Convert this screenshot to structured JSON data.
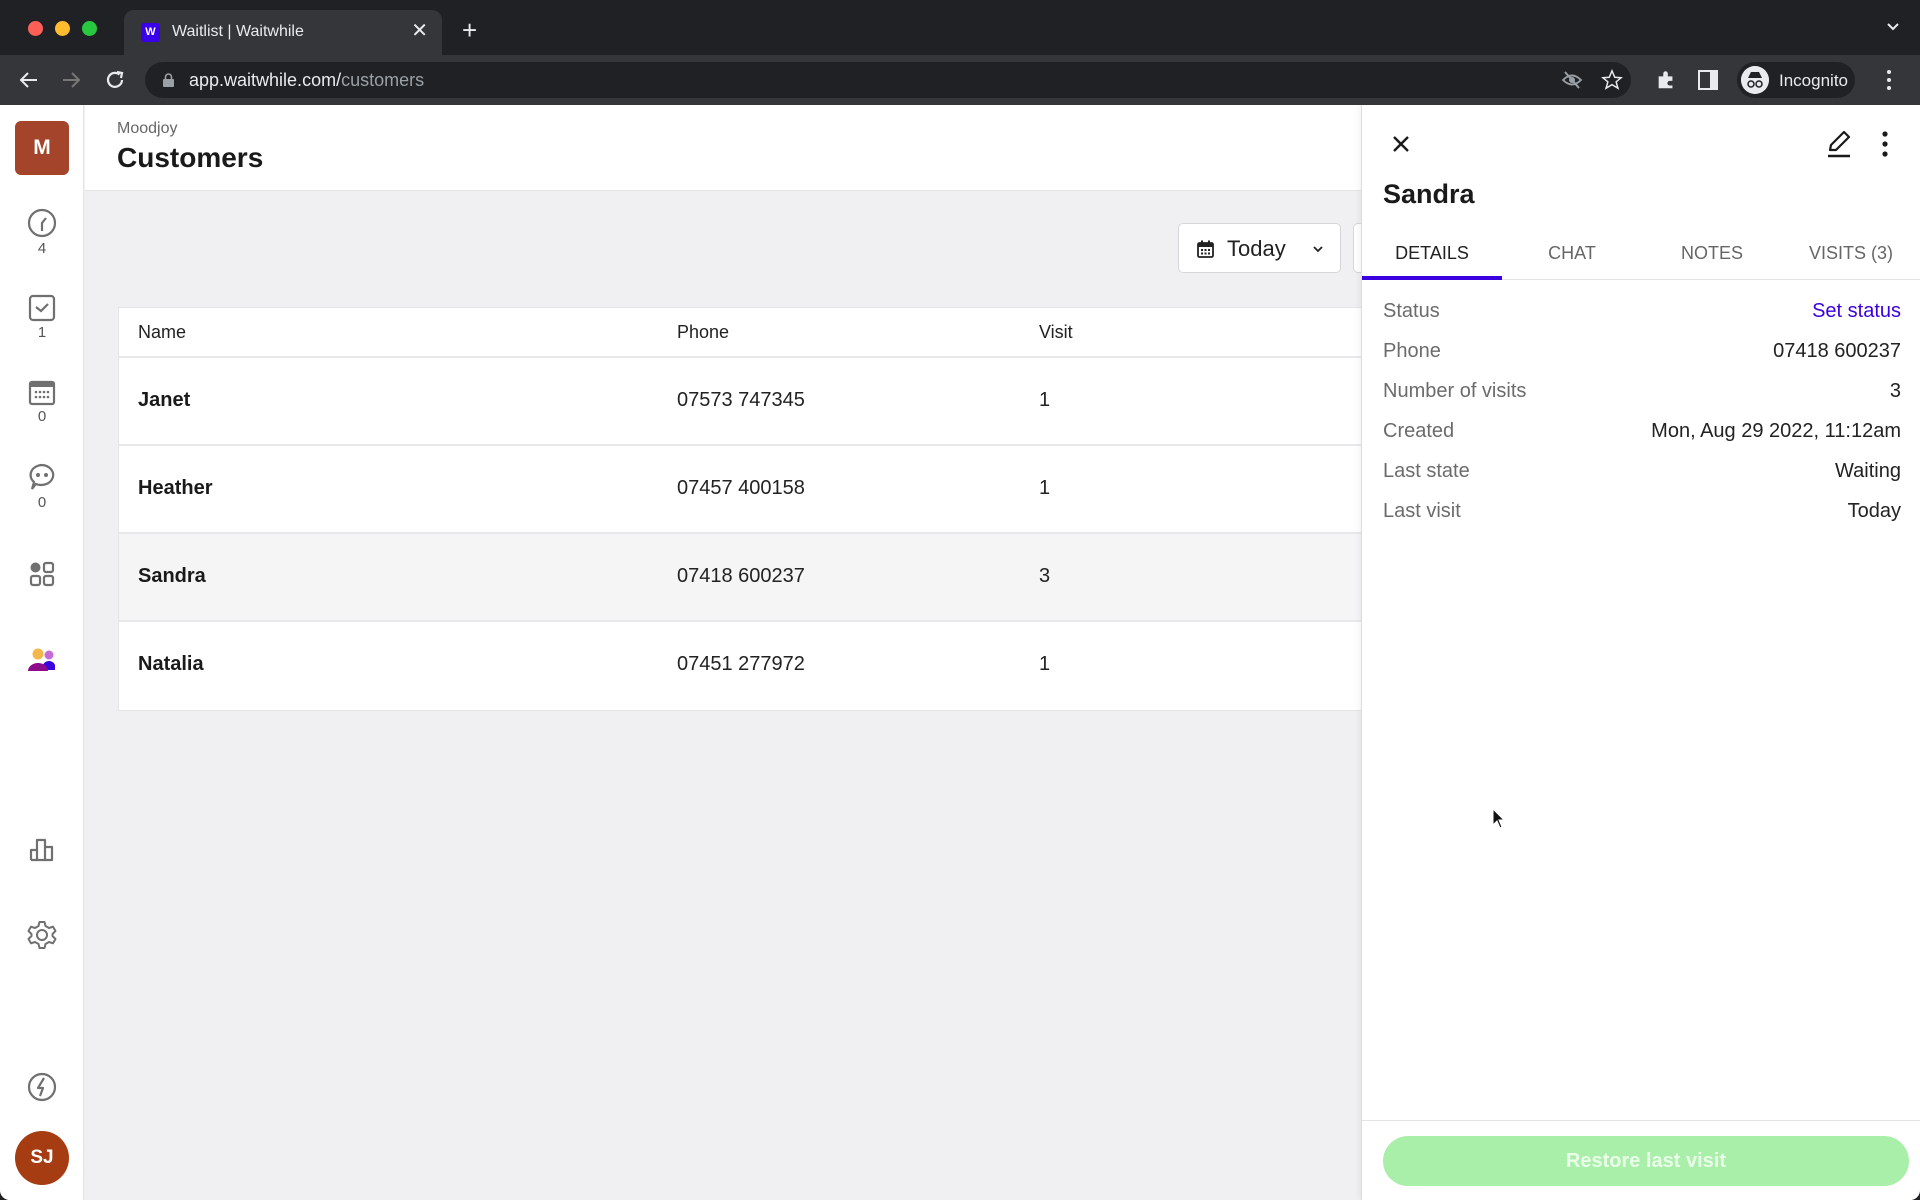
{
  "browser": {
    "tab_title": "Waitlist | Waitwhile",
    "favicon_letter": "W",
    "new_tab_label": "+",
    "url_host": "app.waitwhile.com/",
    "url_path": "customers",
    "profile_label": "Incognito"
  },
  "sidebar": {
    "org_initial": "M",
    "items": [
      {
        "name": "waitlist",
        "icon": "clock-icon",
        "count": "4"
      },
      {
        "name": "served",
        "icon": "check-square-icon",
        "count": "1"
      },
      {
        "name": "bookings",
        "icon": "calendar-icon",
        "count": "0"
      },
      {
        "name": "messages",
        "icon": "chat-bubble-icon",
        "count": "0"
      },
      {
        "name": "apps",
        "icon": "grid-icon"
      },
      {
        "name": "customers",
        "icon": "customers-icon",
        "active": true
      },
      {
        "name": "analytics",
        "icon": "bar-chart-icon"
      },
      {
        "name": "settings",
        "icon": "gear-icon"
      },
      {
        "name": "whats-new",
        "icon": "lightning-icon"
      }
    ],
    "user_initials": "SJ"
  },
  "header": {
    "org_name": "Moodjoy",
    "title": "Customers"
  },
  "filter": {
    "date_label": "Today"
  },
  "table": {
    "columns": [
      "Name",
      "Phone",
      "Visit"
    ],
    "rows": [
      {
        "name": "Janet",
        "phone": "07573 747345",
        "visits": "1"
      },
      {
        "name": "Heather",
        "phone": "07457 400158",
        "visits": "1"
      },
      {
        "name": "Sandra",
        "phone": "07418 600237",
        "visits": "3",
        "selected": true
      },
      {
        "name": "Natalia",
        "phone": "07451 277972",
        "visits": "1"
      }
    ]
  },
  "panel": {
    "customer_name": "Sandra",
    "tabs": [
      "DETAILS",
      "CHAT",
      "NOTES",
      "VISITS (3)"
    ],
    "active_tab": "DETAILS",
    "details": [
      {
        "label": "Status",
        "value": "Set status",
        "link": true
      },
      {
        "label": "Phone",
        "value": "07418 600237"
      },
      {
        "label": "Number of visits",
        "value": "3"
      },
      {
        "label": "Created",
        "value": "Mon, Aug 29 2022, 11:12am"
      },
      {
        "label": "Last state",
        "value": "Waiting"
      },
      {
        "label": "Last visit",
        "value": "Today"
      }
    ],
    "restore_label": "Restore last visit"
  },
  "colors": {
    "accent": "#3a00e0",
    "org_avatar": "#a4442a",
    "user_avatar": "#a53c12",
    "restore_button": "#a9eea9"
  }
}
